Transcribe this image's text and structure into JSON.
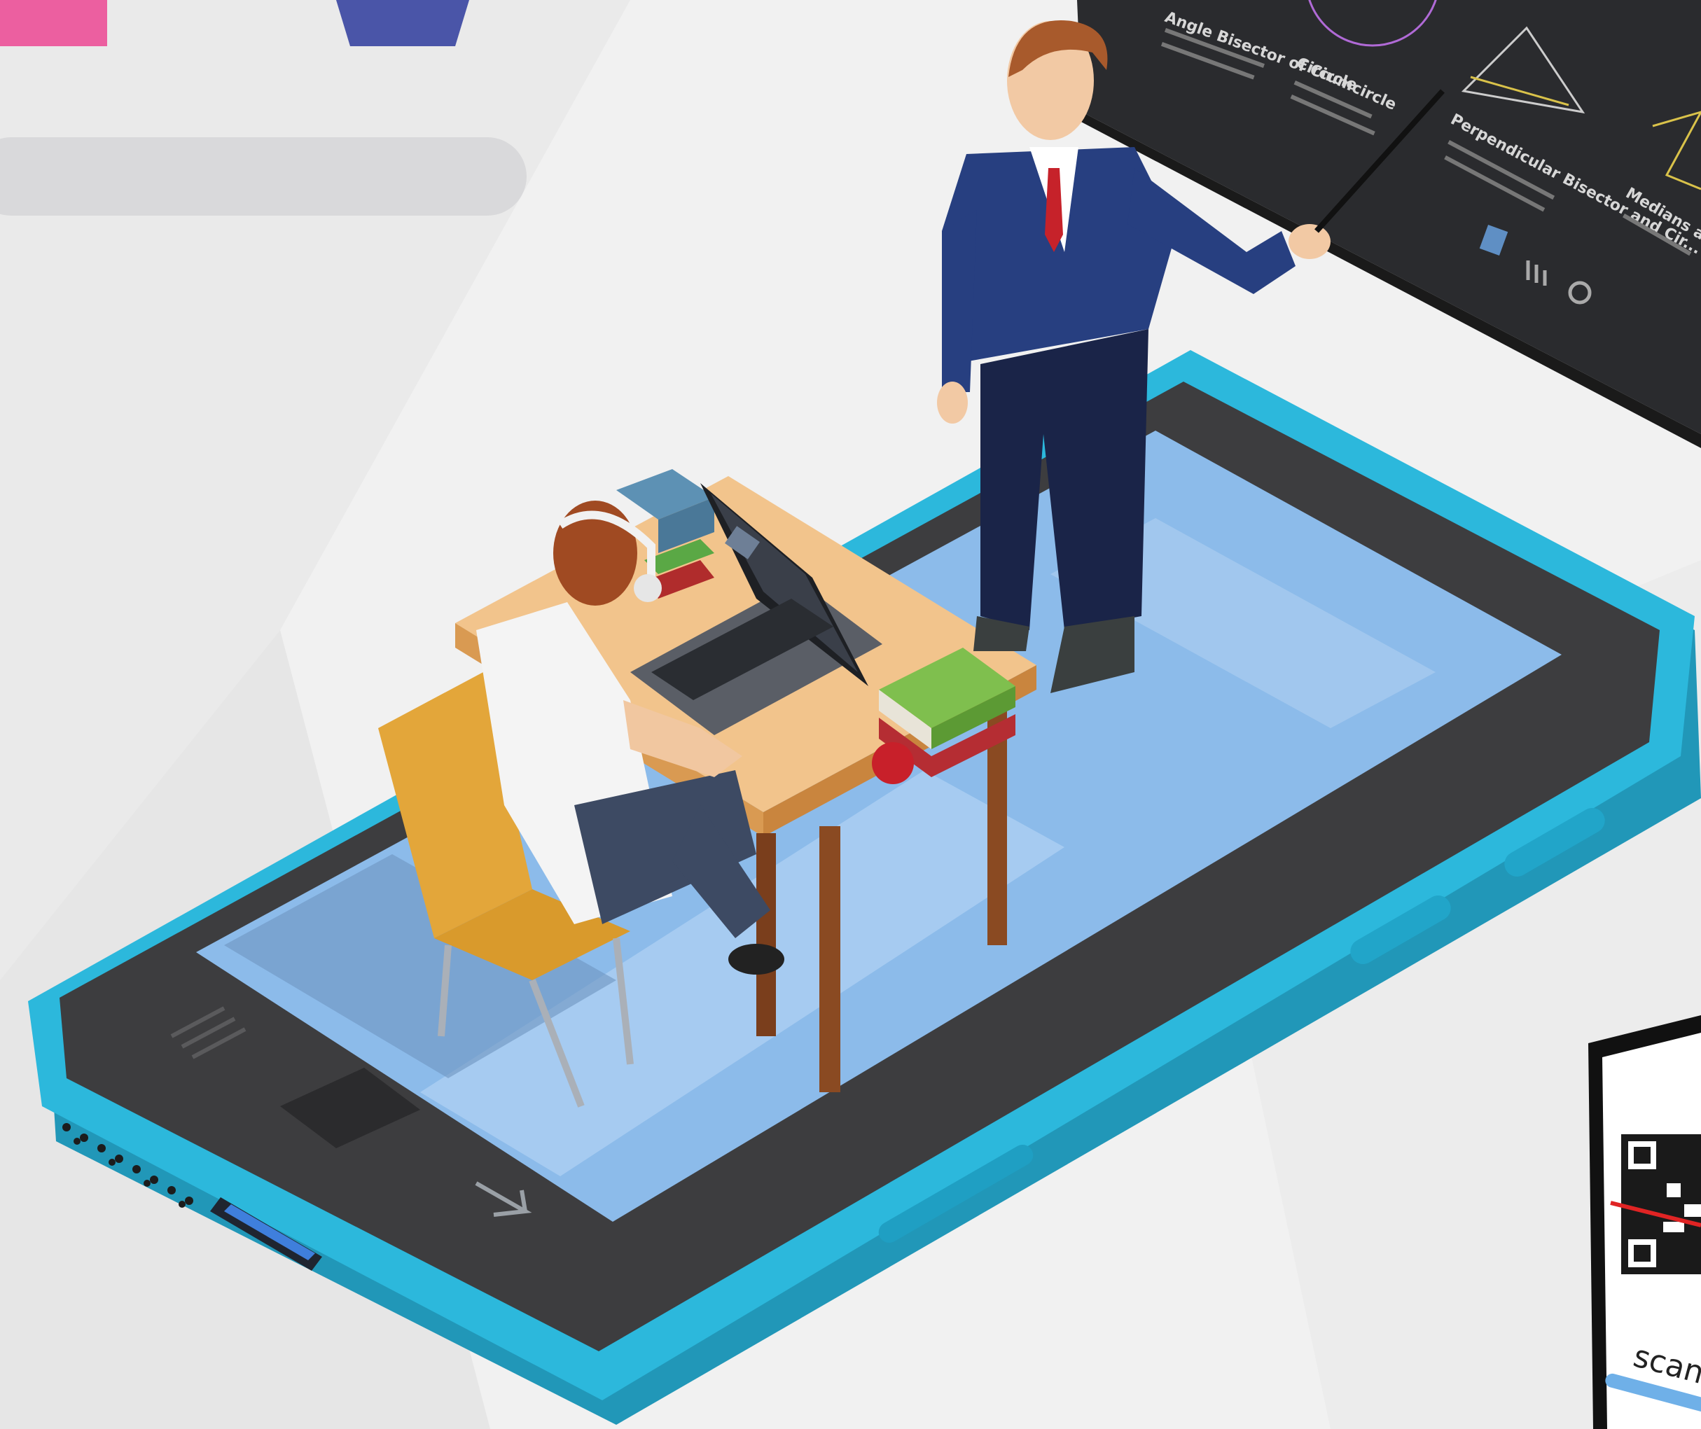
{
  "whiteboard": {
    "card_1_title": "Angle Bisector of Circle",
    "card_2_title": "Circumcircle",
    "card_3_title": "Perpendicular Bisector and Cir...",
    "card_4_title": "Medians and C..."
  },
  "qr_phone": {
    "scan_label": "scann"
  },
  "colors": {
    "background": "#f1f1f1",
    "phone_frame": "#29b6d8",
    "phone_bezel": "#3a3a3a",
    "screen": "#8db9e8",
    "suit": "#233a78",
    "pink_tab": "#ec5fa0",
    "blue_tab": "#4a55a8"
  },
  "icons": [
    "pointer-stick-icon",
    "qr-code-icon",
    "chart-icon",
    "settings-icon",
    "arrow-icon"
  ]
}
